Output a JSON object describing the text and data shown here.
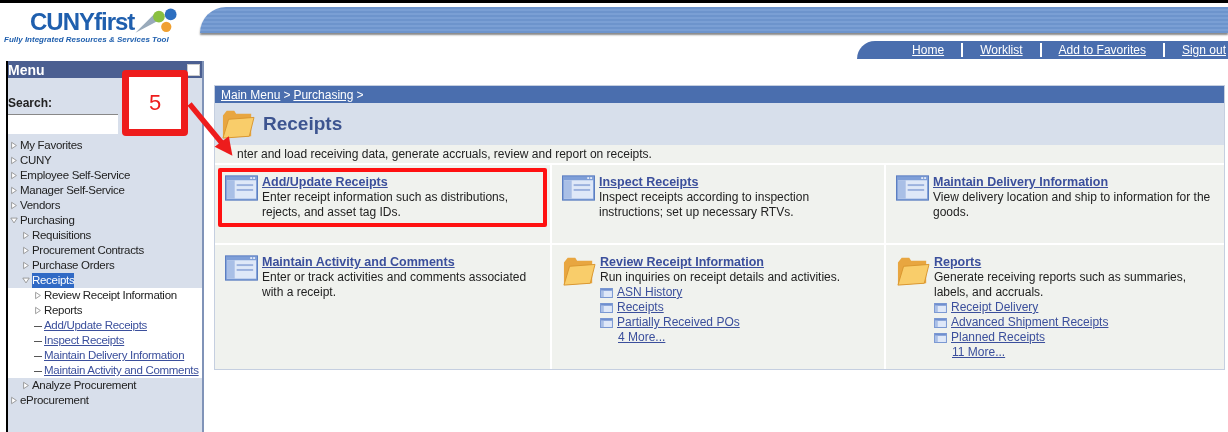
{
  "header": {
    "logo_text": "CUNYfirst",
    "logo_tagline": "Fully Integrated Resources & Services Tool",
    "nav_links": [
      "Home",
      "Worklist",
      "Add to Favorites",
      "Sign out"
    ]
  },
  "menu": {
    "title": "Menu",
    "search_label": "Search:",
    "items": [
      {
        "label": "My Favorites",
        "kind": "folder",
        "expanded": false,
        "selected": false
      },
      {
        "label": "CUNY",
        "kind": "folder",
        "expanded": false,
        "selected": false
      },
      {
        "label": "Employee Self-Service",
        "kind": "folder",
        "expanded": false,
        "selected": false
      },
      {
        "label": "Manager Self-Service",
        "kind": "folder",
        "expanded": false,
        "selected": false
      },
      {
        "label": "Vendors",
        "kind": "folder",
        "expanded": false,
        "selected": false
      },
      {
        "label": "Purchasing",
        "kind": "folder",
        "expanded": true,
        "selected": false,
        "children": [
          {
            "label": "Requisitions",
            "kind": "folder",
            "expanded": false,
            "selected": false
          },
          {
            "label": "Procurement Contracts",
            "kind": "folder",
            "expanded": false,
            "selected": false
          },
          {
            "label": "Purchase Orders",
            "kind": "folder",
            "expanded": false,
            "selected": false
          },
          {
            "label": "Receipts",
            "kind": "folder",
            "expanded": true,
            "selected": true,
            "children": [
              {
                "label": "Review Receipt Information",
                "kind": "folder",
                "expanded": false,
                "selected": false
              },
              {
                "label": "Reports",
                "kind": "folder",
                "expanded": false,
                "selected": false
              },
              {
                "label": "Add/Update Receipts",
                "kind": "link",
                "selected": false
              },
              {
                "label": "Inspect Receipts",
                "kind": "link",
                "selected": false
              },
              {
                "label": "Maintain Delivery Information",
                "kind": "link",
                "selected": false
              },
              {
                "label": "Maintain Activity and Comments",
                "kind": "link",
                "selected": false
              }
            ]
          },
          {
            "label": "Analyze Procurement",
            "kind": "folder",
            "expanded": false,
            "selected": false
          }
        ]
      },
      {
        "label": "eProcurement",
        "kind": "folder",
        "expanded": false,
        "selected": false
      }
    ]
  },
  "breadcrumb": [
    {
      "label": "Main Menu",
      "separator": ">"
    },
    {
      "label": "Purchasing",
      "separator": ">"
    }
  ],
  "page": {
    "title": "Receipts",
    "description": "nter and load receiving data, generate accruals, review and report on receipts."
  },
  "cards": [
    {
      "kind": "page",
      "title": "Add/Update Receipts",
      "description": "Enter receipt information such as distributions, rejects, and asset tag IDs.",
      "highlighted": true
    },
    {
      "kind": "page",
      "title": "Inspect Receipts",
      "description": "Inspect receipts according to inspection instructions; set up necessary RTVs.",
      "highlighted": false
    },
    {
      "kind": "page",
      "title": "Maintain Delivery Information",
      "description": "View delivery location and ship to information for the goods.",
      "highlighted": false
    },
    {
      "kind": "page",
      "title": "Maintain Activity and Comments",
      "description": "Enter or track activities and comments associated with a receipt.",
      "highlighted": false
    },
    {
      "kind": "folder",
      "title": "Review Receipt Information",
      "description": "Run inquiries on receipt details and activities.",
      "links": [
        "ASN History",
        "Receipts",
        "Partially Received POs"
      ],
      "more": "4 More...",
      "highlighted": false
    },
    {
      "kind": "folder",
      "title": "Reports",
      "description": "Generate receiving reports such as summaries, labels, and accruals.",
      "links": [
        "Receipt Delivery",
        "Advanced Shipment Receipts",
        "Planned Receipts"
      ],
      "more": "11 More...",
      "highlighted": false
    }
  ],
  "callout": {
    "number": "5"
  }
}
